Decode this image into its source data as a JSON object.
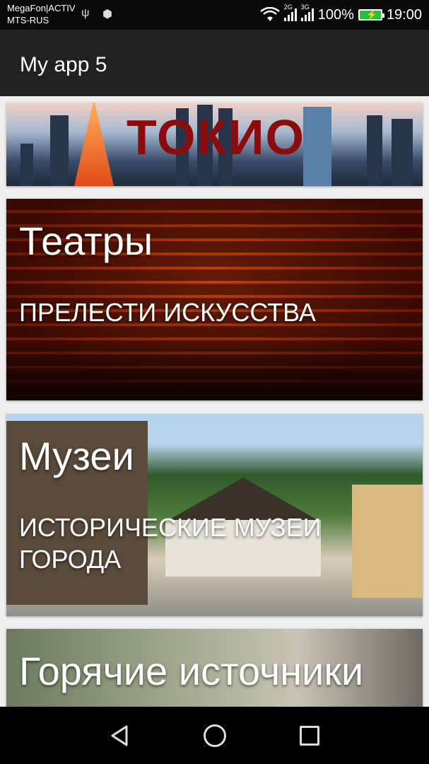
{
  "status_bar": {
    "carrier_line1": "MegaFon|ACTIV",
    "carrier_line2": "MTS-RUS",
    "signal1_label": "2G",
    "signal1_sub": "R",
    "signal2_label": "3G",
    "battery_percent": "100%",
    "time": "19:00",
    "battery_color": "#21c33a"
  },
  "app_bar": {
    "title": "My app 5",
    "background": "#212121"
  },
  "cards": [
    {
      "type": "banner",
      "title": "ТОКИО"
    },
    {
      "type": "category",
      "title": "Театры",
      "subtitle": "ПРЕЛЕСТИ ИСКУССТВА"
    },
    {
      "type": "category",
      "title": "Музеи",
      "subtitle": "ИСТОРИЧЕСКИЕ МУЗЕИ ГОРОДА"
    },
    {
      "type": "category",
      "title": "Горячие источники",
      "subtitle": ""
    }
  ],
  "nav_bar": {
    "back_icon": "triangle-back",
    "home_icon": "circle-home",
    "recent_icon": "square-recents"
  }
}
